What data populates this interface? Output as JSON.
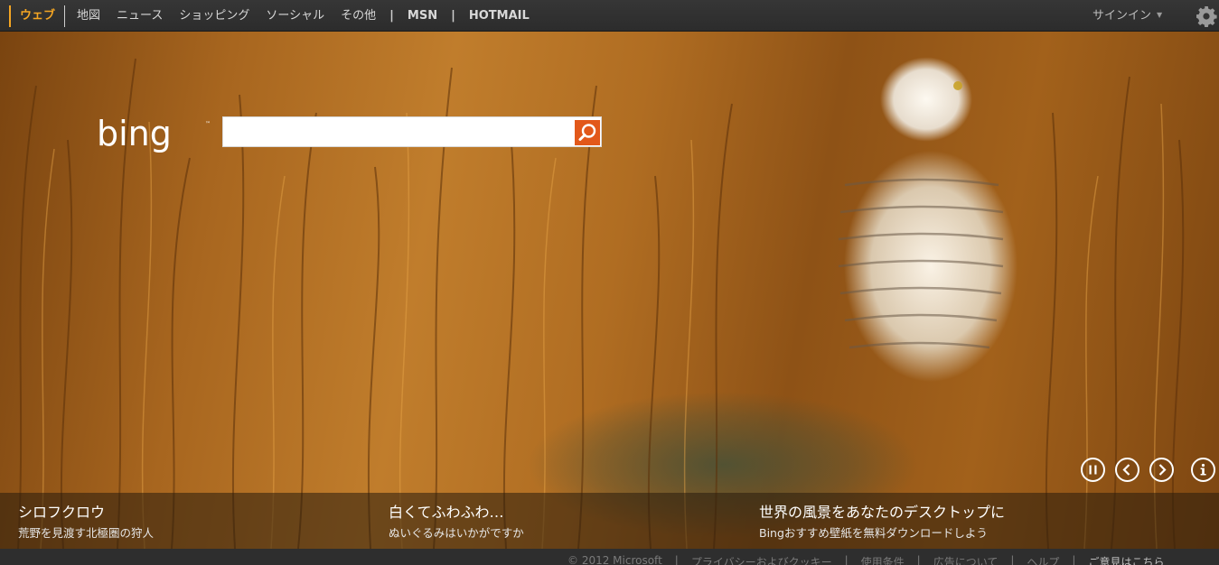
{
  "nav": {
    "items": [
      {
        "label": "ウェブ",
        "active": true
      },
      {
        "label": "地図"
      },
      {
        "label": "ニュース"
      },
      {
        "label": "ショッピング"
      },
      {
        "label": "ソーシャル"
      },
      {
        "label": "その他"
      }
    ],
    "msn_label": "MSN",
    "hotmail_label": "HOTMAIL",
    "separator": "|"
  },
  "account": {
    "signin_label": "サインイン",
    "caret_icon": "chevron-down-icon",
    "settings_icon": "gear-icon"
  },
  "search": {
    "logo_text": "bing",
    "value": "",
    "button_icon": "magnifier-icon",
    "button_color": "#e2581a"
  },
  "controls": {
    "pause_icon": "pause-icon",
    "prev_icon": "chevron-left-icon",
    "next_icon": "chevron-right-icon",
    "info_icon": "info-icon"
  },
  "captions": [
    {
      "title": "シロフクロウ",
      "subtitle": "荒野を見渡す北極圏の狩人"
    },
    {
      "title": "白くてふわふわ…",
      "subtitle": "ぬいぐるみはいかがですか"
    },
    {
      "title": "世界の風景をあなたのデスクトップに",
      "subtitle": "Bingおすすめ壁紙を無料ダウンロードしよう"
    }
  ],
  "footer": {
    "copyright": "© 2012 Microsoft",
    "links": [
      "プライバシーおよびクッキー",
      "使用条件",
      "広告について",
      "ヘルプ"
    ],
    "feedback": "ご意見はこちら",
    "separator": "|"
  },
  "colors": {
    "accent": "#f5a623",
    "topbar": "#333333"
  }
}
